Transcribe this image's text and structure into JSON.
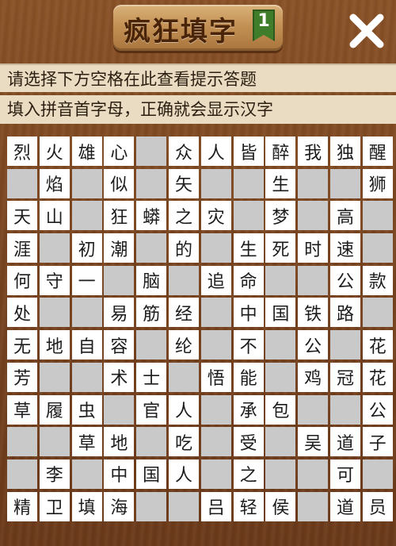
{
  "header": {
    "title": "疯狂填字",
    "level": "1",
    "close_icon": "close-x-icon"
  },
  "hints": {
    "line1": "请选择下方空格在此查看提示答题",
    "line2": "填入拼音首字母，正确就会显示汉字"
  },
  "board": {
    "legend": {
      "#": "empty-cell",
      ".": "no-cell"
    },
    "rows": [
      [
        "烈",
        "火",
        "雄",
        "心",
        "#",
        "众",
        "人",
        "皆",
        "醉",
        "我",
        "独",
        "醒"
      ],
      [
        "#",
        "焰",
        "#",
        "似",
        "#",
        "矢",
        "#",
        "#",
        "生",
        "#",
        "#",
        "狮"
      ],
      [
        "天",
        "山",
        "#",
        "狂",
        "蟒",
        "之",
        "灾",
        "#",
        "梦",
        "#",
        "高",
        "#"
      ],
      [
        "涯",
        "#",
        "初",
        "潮",
        "#",
        "的",
        "#",
        "生",
        "死",
        "时",
        "速",
        "#"
      ],
      [
        "何",
        "守",
        "一",
        "#",
        "脑",
        "#",
        "追",
        "命",
        "#",
        "#",
        "公",
        "款"
      ],
      [
        "处",
        "#",
        "#",
        "易",
        "筋",
        "经",
        "#",
        "中",
        "国",
        "铁",
        "路",
        "#"
      ],
      [
        "无",
        "地",
        "自",
        "容",
        "#",
        "纶",
        "#",
        "不",
        "#",
        "公",
        "#",
        "花"
      ],
      [
        "芳",
        "#",
        "#",
        "术",
        "士",
        "#",
        "悟",
        "能",
        "#",
        "鸡",
        "冠",
        "花"
      ],
      [
        "草",
        "履",
        "虫",
        "#",
        "官",
        "人",
        "#",
        "承",
        "包",
        "#",
        "#",
        "公"
      ],
      [
        "#",
        "#",
        "草",
        "地",
        "#",
        "吃",
        "#",
        "受",
        "#",
        "吴",
        "道",
        "子"
      ],
      [
        "#",
        "李",
        "#",
        "中",
        "国",
        "人",
        "#",
        "之",
        "#",
        "#",
        "可",
        "#"
      ],
      [
        "精",
        "卫",
        "填",
        "海",
        "#",
        "#",
        "吕",
        "轻",
        "侯",
        "#",
        "道",
        "员"
      ]
    ]
  },
  "colors": {
    "background": "#7a4520",
    "hint_bg": "#e9dcc2",
    "cell_filled": "#ffffff",
    "cell_empty": "#c9c9c9",
    "badge": "#3f7d2a"
  }
}
